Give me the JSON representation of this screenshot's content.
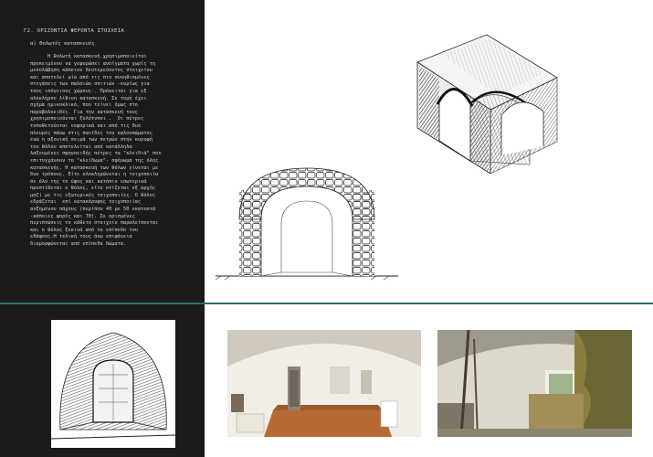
{
  "section": {
    "heading": "Γ2. ΟΡΙΖΟΝΤΙΑ ΦΕΡΟΝΤΑ ΣΤΟΙΧΕΙΑ",
    "subheading": "α) Θολωτές κατασκευές",
    "body": "      Η θολωτή κατασκευή χρησιμοποιείται\nπροκειμένου να γεφυρώσει ανοίγματα χωρίς τη\nμεσολάβηση κάποιου δευτερεύοντος στοιχείου\nκαι αποτελεί μία από τις πιο συνηθισμένες\nστεγάσεις των παλαιών σπιτιών -κυρίως για\nτους ισόγειους χώρους-. Πρόκειται για εξ\nολοκλήρου λίθινη κατασκευή. Σε τομή έχει\nσχήμα ημικυκλικό, που τείνει όμως στο\nπαραβολοειδές. Για την κατασκευή τους\nχρησιμοποιούνται ξυλότυποι .  Οι πέτρες\nτοποθετούνται εκφορικά και από τις δυο\nπλευρές πάνω στις σανίδες του καλουπώματος\nενώ η αξονική σειρά των πετρών στην κορυφή\nτου θόλου αποτελείται από κατάλληλα\nλαξευμένες σφηνοειδής πέτρες τα \"κλειδιά\" που\nεπιτυγχάνουν το \"κλείδωμα\"- σφήνωμα της όλης\nκατασκευής. Η κατασκευή των θόλων γίνεται με\nδυο τρόπους. Είτε ολοκληρώνεται η τοιχοποιία\nσε όλο της το ύψος και κατόπιν εσωτερικά\nπροστίθεται ο θόλος, είτε κτίζεται εξ αρχής\nμαζί με τις εξωτερικές τοιχοποιίες. Ο θόλος\nεδράζεται  επί κατακόρυφης τοιχοποιίας\nαυξημένου πάχους (περίπου 40 με 50 εκατοστά\n-κάποιες φορές και 70). Σε ορισμένες\nπεριπτώσεις το κάθετο στοιχείο παραλείπονται\nκαι ο θόλος ξεκινά από το επίπεδο του\nεδάφους.Η τελική τους άνω επιφάνεια\nδιαμορφώνεται από επίπεδα δώματα."
  },
  "colors": {
    "panel": "#1b1b1b",
    "divider": "#2f6f6a",
    "text": "#d4d4d4"
  }
}
